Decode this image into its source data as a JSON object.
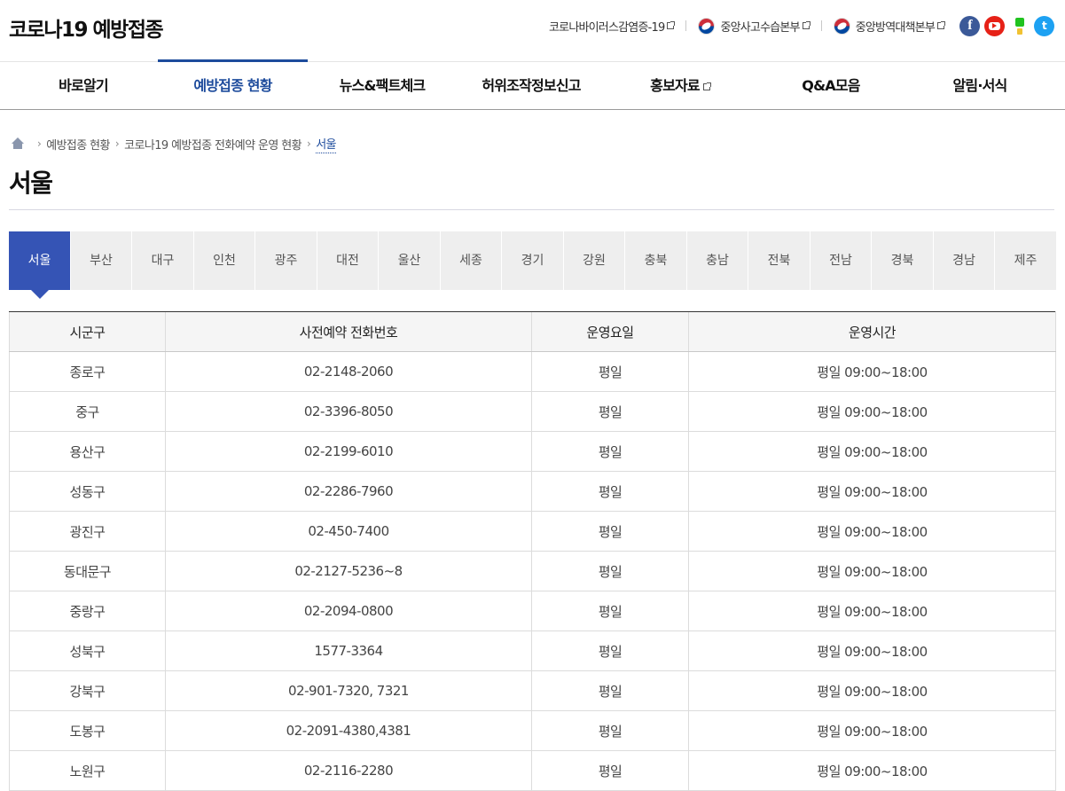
{
  "header": {
    "logo": "코로나19 예방접종",
    "links": [
      {
        "label": "코로나바이러스감염증-19",
        "icon": "external-link-icon"
      },
      {
        "label": "중앙사고수습본부",
        "icon": "taegeuk-icon"
      },
      {
        "label": "중앙방역대책본부",
        "icon": "taegeuk-icon"
      }
    ],
    "social": [
      {
        "name": "facebook-icon",
        "glyph": "f",
        "color": "#3b5998"
      },
      {
        "name": "youtube-icon",
        "glyph": "",
        "color": "#e62117"
      },
      {
        "name": "blog-icon",
        "glyph": "",
        "color": "#20c31f"
      },
      {
        "name": "twitter-icon",
        "glyph": "t",
        "color": "#1da1f2"
      }
    ]
  },
  "nav": {
    "items": [
      "바로알기",
      "예방접종 현황",
      "뉴스&팩트체크",
      "허위조작정보신고",
      "홍보자료",
      "Q&A모음",
      "알림·서식"
    ],
    "active_index": 1,
    "accent": "#1d4b9c"
  },
  "breadcrumb": [
    "예방접종 현황",
    "코로나19 예방접종 전화예약 운영 현황",
    "서울"
  ],
  "page_title": "서울",
  "region_tabs": {
    "items": [
      "서울",
      "부산",
      "대구",
      "인천",
      "광주",
      "대전",
      "울산",
      "세종",
      "경기",
      "강원",
      "충북",
      "충남",
      "전북",
      "전남",
      "경북",
      "경남",
      "제주"
    ],
    "active_index": 0,
    "active_color": "#3554b5"
  },
  "table": {
    "headers": [
      "시군구",
      "사전예약 전화번호",
      "운영요일",
      "운영시간"
    ],
    "rows": [
      [
        "종로구",
        "02-2148-2060",
        "평일",
        "평일 09:00~18:00"
      ],
      [
        "중구",
        "02-3396-8050",
        "평일",
        "평일 09:00~18:00"
      ],
      [
        "용산구",
        "02-2199-6010",
        "평일",
        "평일 09:00~18:00"
      ],
      [
        "성동구",
        "02-2286-7960",
        "평일",
        "평일 09:00~18:00"
      ],
      [
        "광진구",
        "02-450-7400",
        "평일",
        "평일 09:00~18:00"
      ],
      [
        "동대문구",
        "02-2127-5236~8",
        "평일",
        "평일 09:00~18:00"
      ],
      [
        "중랑구",
        "02-2094-0800",
        "평일",
        "평일 09:00~18:00"
      ],
      [
        "성북구",
        "1577-3364",
        "평일",
        "평일 09:00~18:00"
      ],
      [
        "강북구",
        "02-901-7320, 7321",
        "평일",
        "평일 09:00~18:00"
      ],
      [
        "도봉구",
        "02-2091-4380,4381",
        "평일",
        "평일 09:00~18:00"
      ],
      [
        "노원구",
        "02-2116-2280",
        "평일",
        "평일 09:00~18:00"
      ]
    ]
  }
}
